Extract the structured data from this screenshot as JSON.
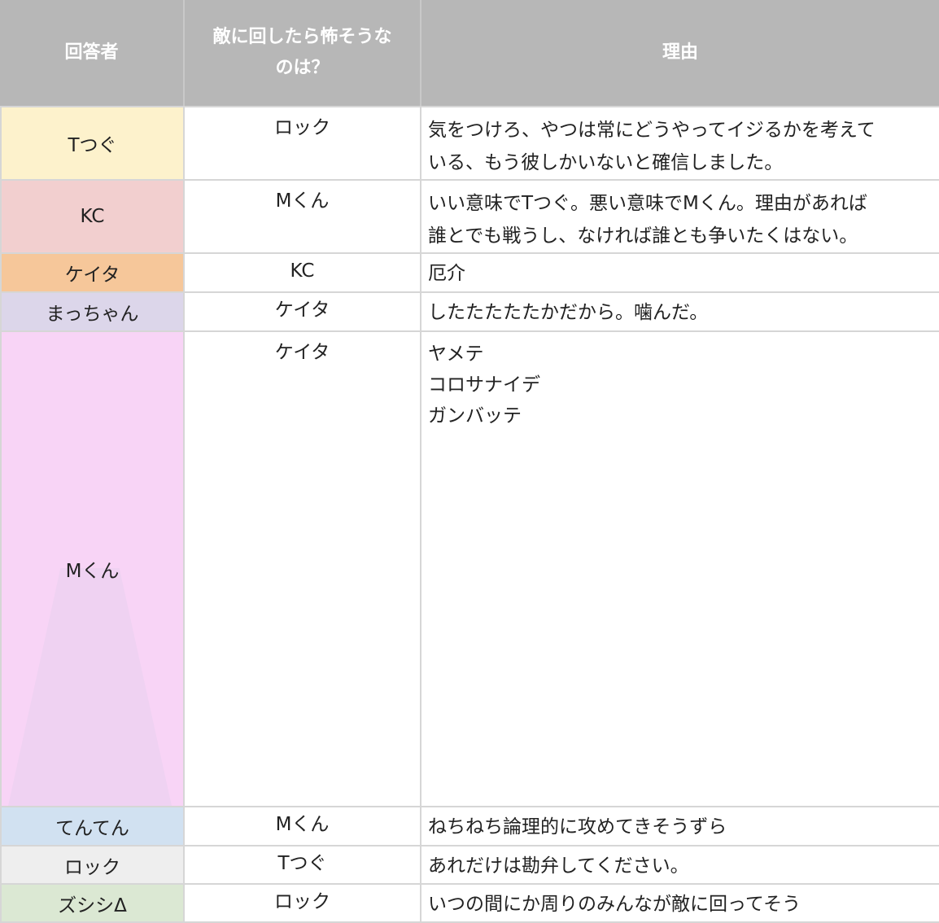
{
  "header": {
    "col1": "回答者",
    "col2_line1": "敵に回したら怖そうな",
    "col2_line2": "のは？",
    "col3": "理由"
  },
  "rows": [
    {
      "name": "Tつぐ",
      "bg": "#fdf2cc",
      "pick": "ロック",
      "reason": [
        "気をつけろ、やつは常にどうやってイジるかを考えて",
        "いる、もう彼しかいないと確信しました。"
      ]
    },
    {
      "name": "KC",
      "bg": "#f2cfcf",
      "pick": "Mくん",
      "reason": [
        "いい意味でTつぐ。悪い意味でMくん。理由があれば",
        "誰とでも戦うし、なければ誰とも争いたくはない。"
      ]
    },
    {
      "name": "ケイタ",
      "bg": "#f6c79a",
      "pick": "KC",
      "reason": [
        "厄介"
      ]
    },
    {
      "name": "まっちゃん",
      "bg": "#dcd6ea",
      "pick": "ケイタ",
      "reason": [
        "したたたたたかだから。噛んだ。"
      ]
    },
    {
      "name": "Mくん",
      "bg": "#f8d4f6",
      "pick": "ケイタ",
      "reason": [
        "ヤメテ",
        "コロサナイデ",
        "ガンバッテ"
      ]
    },
    {
      "name": "てんてん",
      "bg": "#d1e1f1",
      "pick": "Mくん",
      "reason": [
        "ねちねち論理的に攻めてきそうずら"
      ]
    },
    {
      "name": "ロック",
      "bg": "#eeeeee",
      "pick": "Tつぐ",
      "reason": [
        "あれだけは勘弁してください。"
      ]
    },
    {
      "name": "ズシシΔ",
      "bg": "#dbe8d3",
      "pick": "ロック",
      "reason": [
        "いつの間にか周りのみんなが敵に回ってそう"
      ]
    }
  ]
}
